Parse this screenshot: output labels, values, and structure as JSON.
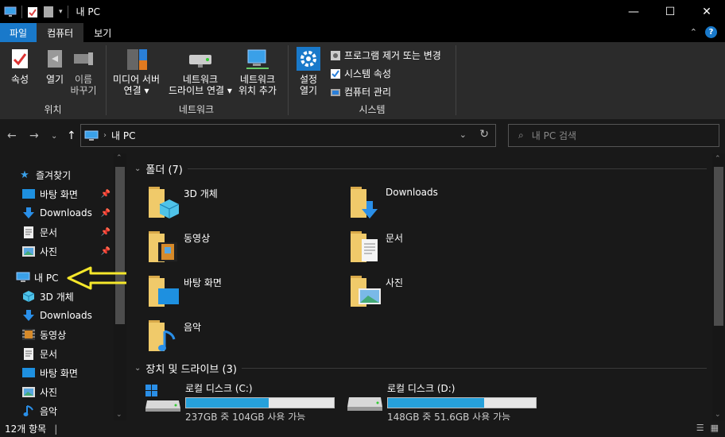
{
  "window": {
    "title": "내 PC",
    "controls": {
      "minimize": "—",
      "maximize": "☐",
      "close": "✕"
    }
  },
  "ribbon_tabs": [
    "파일",
    "컴퓨터",
    "보기"
  ],
  "ribbon": {
    "groups": {
      "location": {
        "label": "위치",
        "properties": "속성",
        "open": "열기",
        "rename_1": "이름",
        "rename_2": "바꾸기"
      },
      "network": {
        "label": "네트워크",
        "media_1": "미디어 서버",
        "media_2": "연결",
        "drive_1": "네트워크",
        "drive_2": "드라이브 연결",
        "netloc_1": "네트워크",
        "netloc_2": "위치 추가"
      },
      "system": {
        "label": "시스템",
        "settings_1": "설정",
        "settings_2": "열기",
        "uninstall": "프로그램 제거 또는 변경",
        "sysprops": "시스템 속성",
        "manage": "컴퓨터 관리"
      }
    }
  },
  "address": {
    "path": "내 PC",
    "search_placeholder": "내 PC 검색"
  },
  "nav": {
    "quick_access": "즐겨찾기",
    "quick_items": [
      "바탕 화면",
      "Downloads",
      "문서",
      "사진"
    ],
    "this_pc": "내 PC",
    "pc_items": [
      "3D 개체",
      "Downloads",
      "동영상",
      "문서",
      "바탕 화면",
      "사진",
      "음악"
    ]
  },
  "content": {
    "folders_header": "폴더 (7)",
    "folders": [
      "3D 개체",
      "Downloads",
      "동영상",
      "문서",
      "바탕 화면",
      "사진",
      "음악"
    ],
    "drives_header": "장치 및 드라이브 (3)",
    "drives": [
      {
        "name": "로컬 디스크 (C:)",
        "free": "237GB 중 104GB 사용 가능",
        "used_fraction": 0.56
      },
      {
        "name": "로컬 디스크 (D:)",
        "free": "148GB 중 51.6GB 사용 가능",
        "used_fraction": 0.65
      }
    ]
  },
  "status": {
    "count": "12개 항목"
  },
  "colors": {
    "accent": "#1979ca",
    "folder": "#e8c36a",
    "drive_bar": "#26a0da",
    "annotation": "#f5e72b"
  }
}
